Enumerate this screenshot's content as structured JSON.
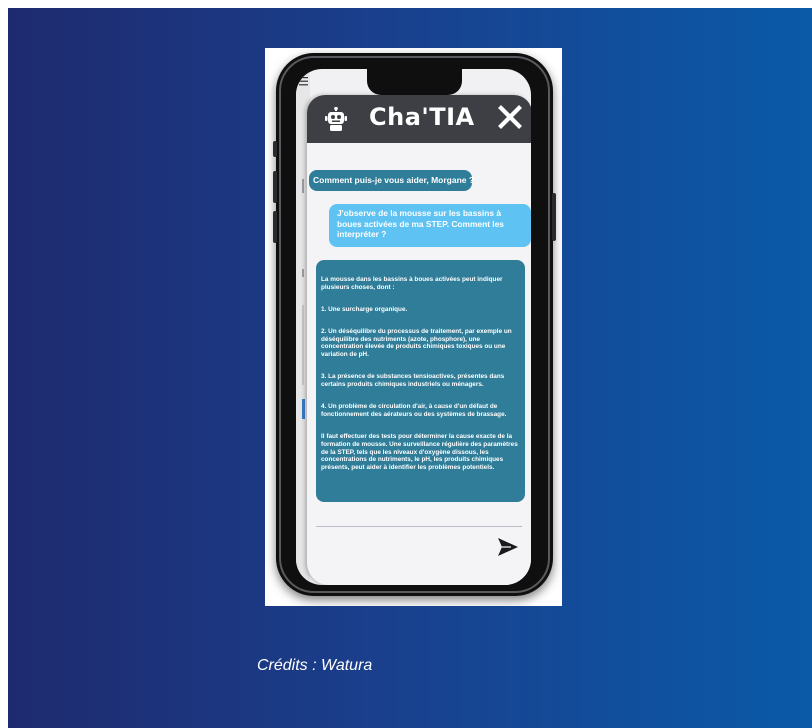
{
  "chat": {
    "title": "Cha'TIA",
    "messages": {
      "bot_greeting": "Comment puis-je vous aider, Morgane ?",
      "user_question": "J'observe de la mousse sur les bassins à boues activées de ma STEP. Comment les interpréter ?",
      "bot_answer": [
        "        La mousse dans les bassins à boues activées peut indiquer plusieurs choses, dont :",
        "1. Une surcharge organique.",
        "2. Un déséquilibre du processus de traitement, par exemple un déséquilibre des nutriments (azote, phosphore), une concentration élevée de produits chimiques toxiques ou une variation de pH.",
        "3. La présence de substances tensioactives, présentes dans certains produits chimiques industriels ou ménagers.",
        "4. Un problème de circulation d'air, à cause d'un défaut de fonctionnement des aérateurs ou des systèmes de brassage.",
        "        Il faut effectuer des tests pour déterminer la cause exacte de la formation de mousse. Une surveillance régulière des paramètres de la STEP, tels que les niveaux d'oxygène dissous, les concentrations de nutriments, le pH, les produits chimiques présents, peut aider à identifier les problèmes potentiels."
      ]
    },
    "icons": {
      "header_left": "robot-icon",
      "header_right": "close-icon",
      "send": "send-icon",
      "menu": "hamburger-icon"
    },
    "colors": {
      "header_bg": "#3d3f45",
      "bot_bubble": "#2f7d98",
      "user_bubble": "#5ec3f2"
    }
  },
  "caption": "Crédits : Watura"
}
